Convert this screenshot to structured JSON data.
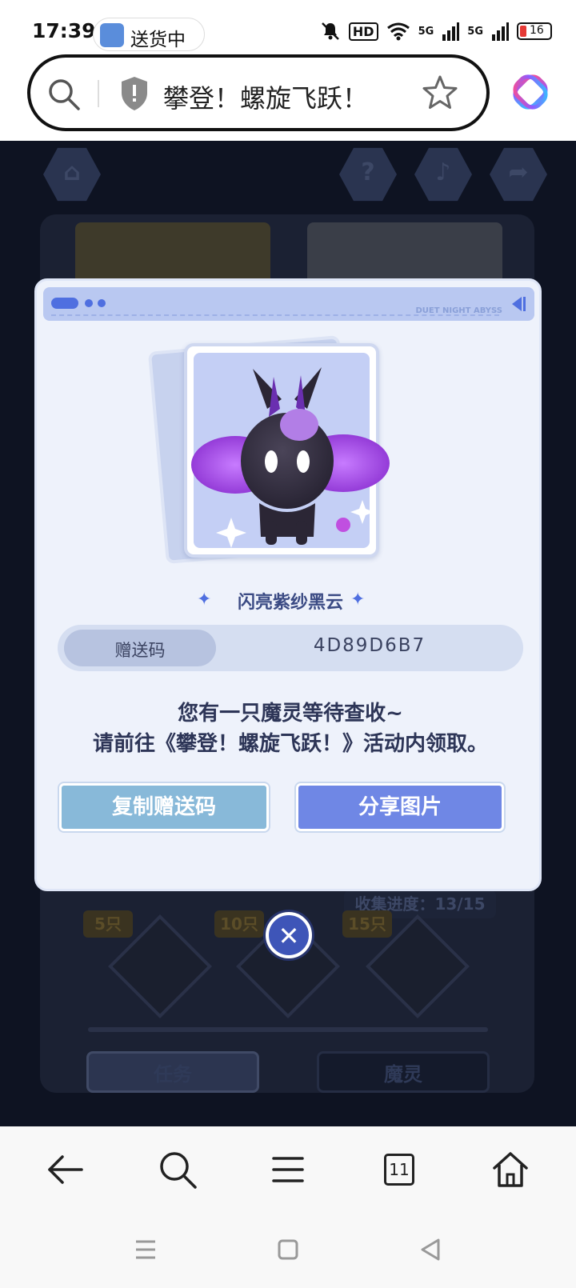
{
  "status_bar": {
    "time": "17:39",
    "delivery_label": "送货中",
    "hd_label": "HD",
    "network_1": "5G",
    "network_2": "5G",
    "battery": "16",
    "battery_color": "#e53935"
  },
  "address_bar": {
    "title": "攀登！螺旋飞跃！",
    "icons": [
      "search-icon",
      "shield-icon",
      "star-icon",
      "app-logo-icon"
    ]
  },
  "game": {
    "nav_icons": [
      "home-icon",
      "help-icon",
      "music-icon",
      "share-icon"
    ],
    "progress_label": "收集进度：13/15",
    "reward_tags": [
      "5只",
      "10只",
      "15只"
    ],
    "task_button": "任务",
    "spirit_button": "魔灵"
  },
  "modal": {
    "header_brand": "DUET NIGHT ABYSS",
    "creature_name": "闪亮紫纱黑云",
    "code_label": "赠送码",
    "code_value": "4D89D6B7",
    "message_line1": "您有一只魔灵等待查收~",
    "message_line2": "请前往《攀登！螺旋飞跃！》活动内领取。",
    "copy_button": "复制赠送码",
    "share_button": "分享图片",
    "accent_color": "#6f87e5",
    "copy_color": "#88b9d9"
  },
  "browser_nav": {
    "tab_count": "11",
    "icons": [
      "back-icon",
      "search-icon",
      "menu-icon",
      "tabs-icon",
      "home-icon"
    ]
  },
  "system_nav": {
    "icons": [
      "recent-apps-icon",
      "home-square-icon",
      "back-triangle-icon"
    ]
  }
}
